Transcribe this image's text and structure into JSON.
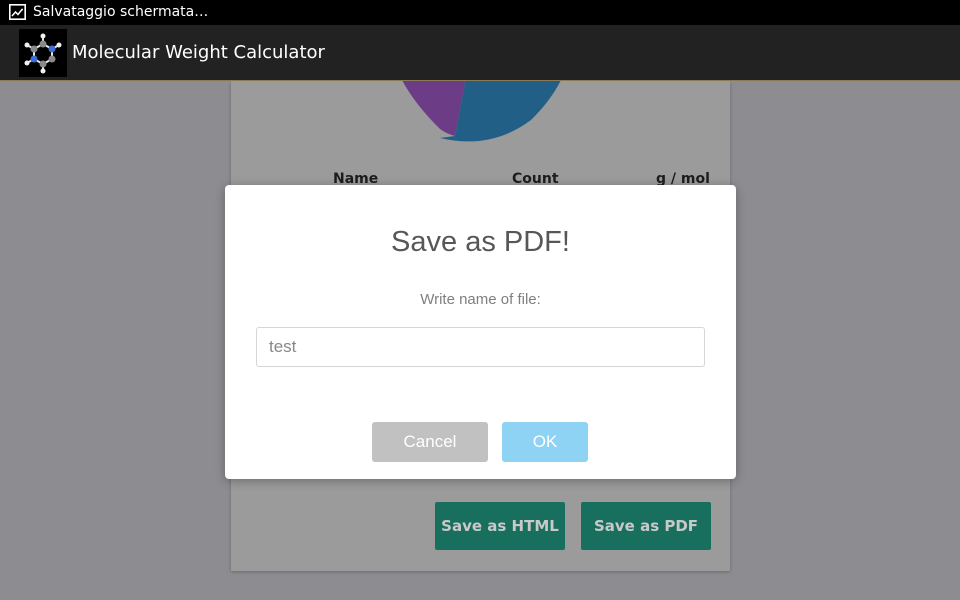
{
  "status_bar": {
    "notification_text": "Salvataggio schermata…",
    "icon": "image-icon"
  },
  "app_bar": {
    "title": "Molecular Weight Calculator",
    "logo_icon": "molecule-icon"
  },
  "background_card": {
    "pie_colors": {
      "purple": "#6c3d86",
      "blue": "#225f87"
    },
    "table_headers": {
      "name": "Name",
      "count": "Count",
      "gmol": "g / mol"
    },
    "buttons": {
      "save_html": "Save as HTML",
      "save_pdf": "Save as PDF"
    },
    "accent_color": "#186f5e"
  },
  "dialog": {
    "title": "Save as PDF!",
    "subtitle": "Write name of file:",
    "input_value": "test",
    "cancel_label": "Cancel",
    "ok_label": "OK"
  }
}
